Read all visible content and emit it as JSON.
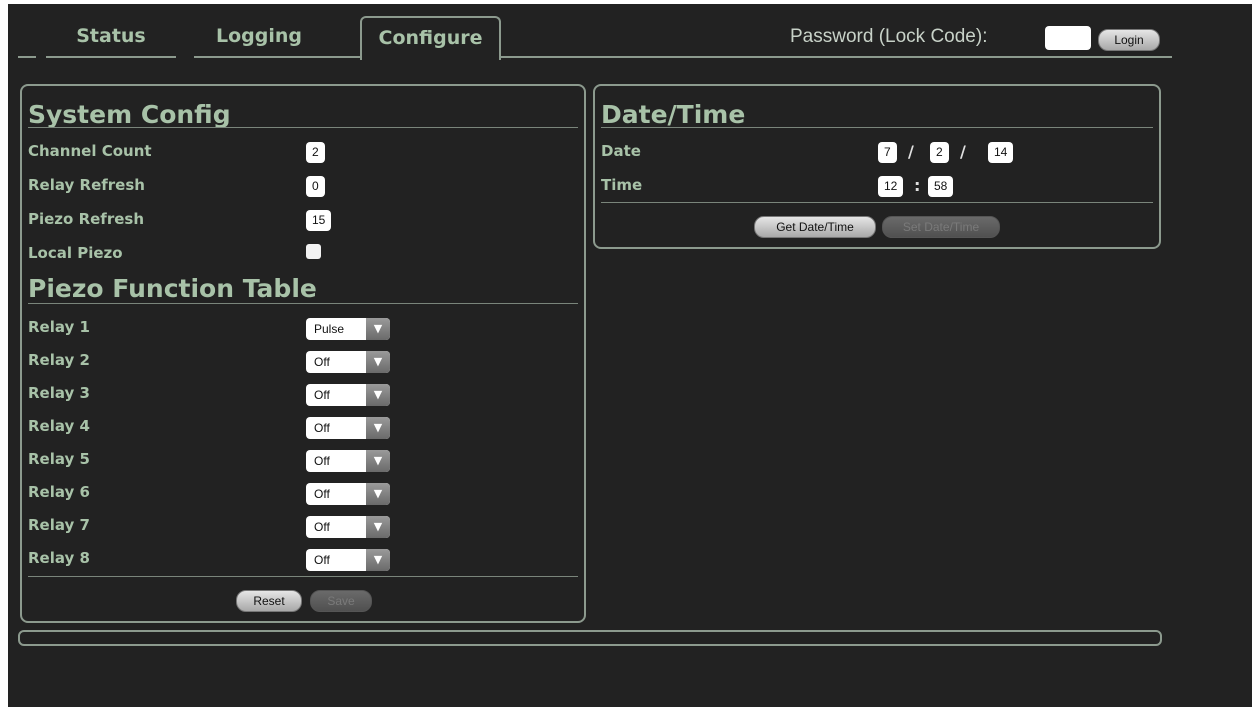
{
  "tabs": [
    {
      "label": "Status"
    },
    {
      "label": "Logging"
    },
    {
      "label": "Configure",
      "active": true
    }
  ],
  "auth": {
    "password_label": "Password (Lock Code):",
    "password_value": "",
    "login_label": "Login"
  },
  "system_config": {
    "title": "System Config",
    "fields": [
      {
        "label": "Channel Count",
        "value": "2"
      },
      {
        "label": "Relay Refresh",
        "value": "0"
      },
      {
        "label": "Piezo Refresh",
        "value": "15"
      }
    ],
    "local_piezo": {
      "label": "Local Piezo",
      "checked": false
    }
  },
  "piezo_table": {
    "title": "Piezo Function Table",
    "rows": [
      {
        "label": "Relay 1",
        "value": "Pulse"
      },
      {
        "label": "Relay 2",
        "value": "Off"
      },
      {
        "label": "Relay 3",
        "value": "Off"
      },
      {
        "label": "Relay 4",
        "value": "Off"
      },
      {
        "label": "Relay 5",
        "value": "Off"
      },
      {
        "label": "Relay 6",
        "value": "Off"
      },
      {
        "label": "Relay 7",
        "value": "Off"
      },
      {
        "label": "Relay 8",
        "value": "Off"
      }
    ],
    "reset_label": "Reset",
    "save_label": "Save"
  },
  "datetime": {
    "title": "Date/Time",
    "date_label": "Date",
    "date": {
      "month": "7",
      "day": "2",
      "year": "14"
    },
    "date_sep": "/",
    "time_label": "Time",
    "time": {
      "hour": "12",
      "minute": "58"
    },
    "time_sep": ":",
    "get_label": "Get Date/Time",
    "set_label": "Set Date/Time"
  }
}
